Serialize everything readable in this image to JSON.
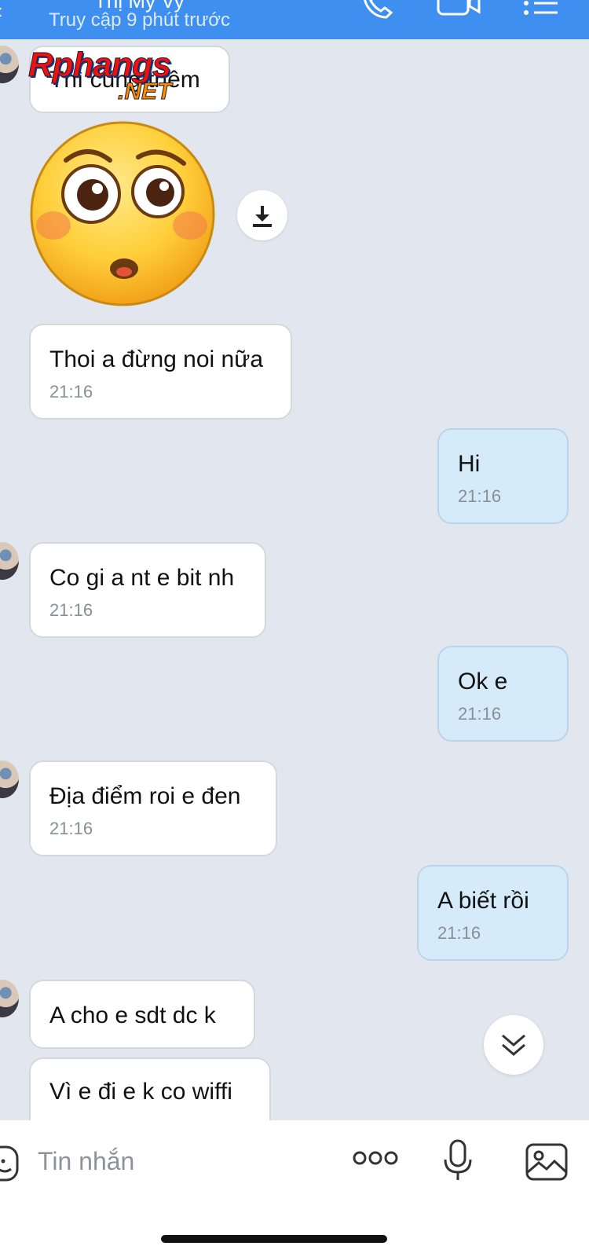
{
  "header": {
    "contact_name_partial": "Thị Mỹ Vy",
    "status": "Truy cập 9 phút trước",
    "icons": [
      "back-arrow-icon",
      "phone-icon",
      "video-call-icon",
      "menu-list-icon"
    ]
  },
  "watermark": {
    "line1": "Rphangs",
    "line2": ".NET"
  },
  "messages": [
    {
      "direction": "in",
      "text": "Thì cũng thêm",
      "time": ""
    },
    {
      "direction": "in",
      "type": "sticker",
      "sticker": "flushed-face-emoji"
    },
    {
      "direction": "in",
      "text": "Thoi a đừng noi nữa",
      "time": "21:16"
    },
    {
      "direction": "out",
      "text": "Hi",
      "time": "21:16"
    },
    {
      "direction": "in",
      "text": "Co gi a nt e bit nh",
      "time": "21:16"
    },
    {
      "direction": "out",
      "text": "Ok e",
      "time": "21:16"
    },
    {
      "direction": "in",
      "text": "Địa điểm roi e đen",
      "time": "21:16"
    },
    {
      "direction": "out",
      "text": "A biết rồi",
      "time": "21:16"
    },
    {
      "direction": "in",
      "text": "A cho e sdt dc k",
      "time": ""
    },
    {
      "direction": "in",
      "text": "Vì e đi e k co wiffi",
      "time": ""
    }
  ],
  "input": {
    "placeholder": "Tin nhắn",
    "icons": [
      "emoji-icon",
      "more-options-icon",
      "microphone-icon",
      "image-icon"
    ]
  },
  "colors": {
    "header": "#3f8ff0",
    "chat_background": "#e2e6ef",
    "incoming_bubble": "#ffffff",
    "outgoing_bubble": "#d6ebfa"
  }
}
